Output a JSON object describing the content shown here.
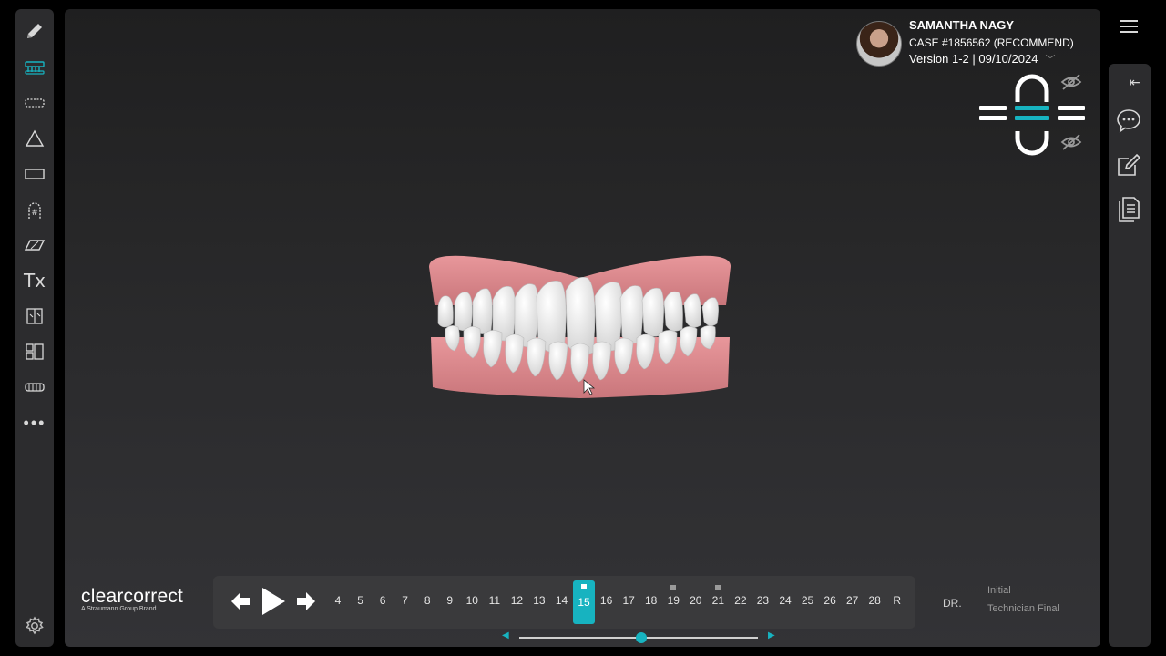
{
  "patient": {
    "name": "SAMANTHA NAGY",
    "case": "CASE #1856562 (RECOMMEND)",
    "version": "Version 1-2 | 09/10/2024"
  },
  "left_toolbar": {
    "tools": [
      {
        "icon": "pencil-icon"
      },
      {
        "icon": "aligner-attachments-icon"
      },
      {
        "icon": "arch-view-icon"
      },
      {
        "icon": "triangle-icon"
      },
      {
        "icon": "rectangle-icon"
      },
      {
        "icon": "tooth-numbering-icon"
      },
      {
        "icon": "parallelogram-icon"
      },
      {
        "icon": "tx-text",
        "label": "Tx"
      },
      {
        "icon": "compare-icon"
      },
      {
        "icon": "layout-icon"
      },
      {
        "icon": "full-arch-icon"
      },
      {
        "icon": "more-icon",
        "label": "•••"
      }
    ],
    "settings_icon": "gear-icon"
  },
  "timeline": {
    "stages": [
      "4",
      "5",
      "6",
      "7",
      "8",
      "9",
      "10",
      "11",
      "12",
      "13",
      "14",
      "15",
      "16",
      "17",
      "18",
      "19",
      "20",
      "21",
      "22",
      "23",
      "24",
      "25",
      "26",
      "27",
      "28",
      "R"
    ],
    "active_stage": "15",
    "marked_stages": [
      "15",
      "19",
      "21"
    ],
    "slider_value": 0.51
  },
  "brand": {
    "logo": "clearcorrect",
    "tagline": "A Straumann Group Brand"
  },
  "labels": {
    "dr": "DR.",
    "initial": "Initial",
    "technician_final": "Technician Final"
  },
  "colors": {
    "accent": "#17b3c0",
    "gum": "#e38f93",
    "tooth": "#f3f3f3"
  }
}
